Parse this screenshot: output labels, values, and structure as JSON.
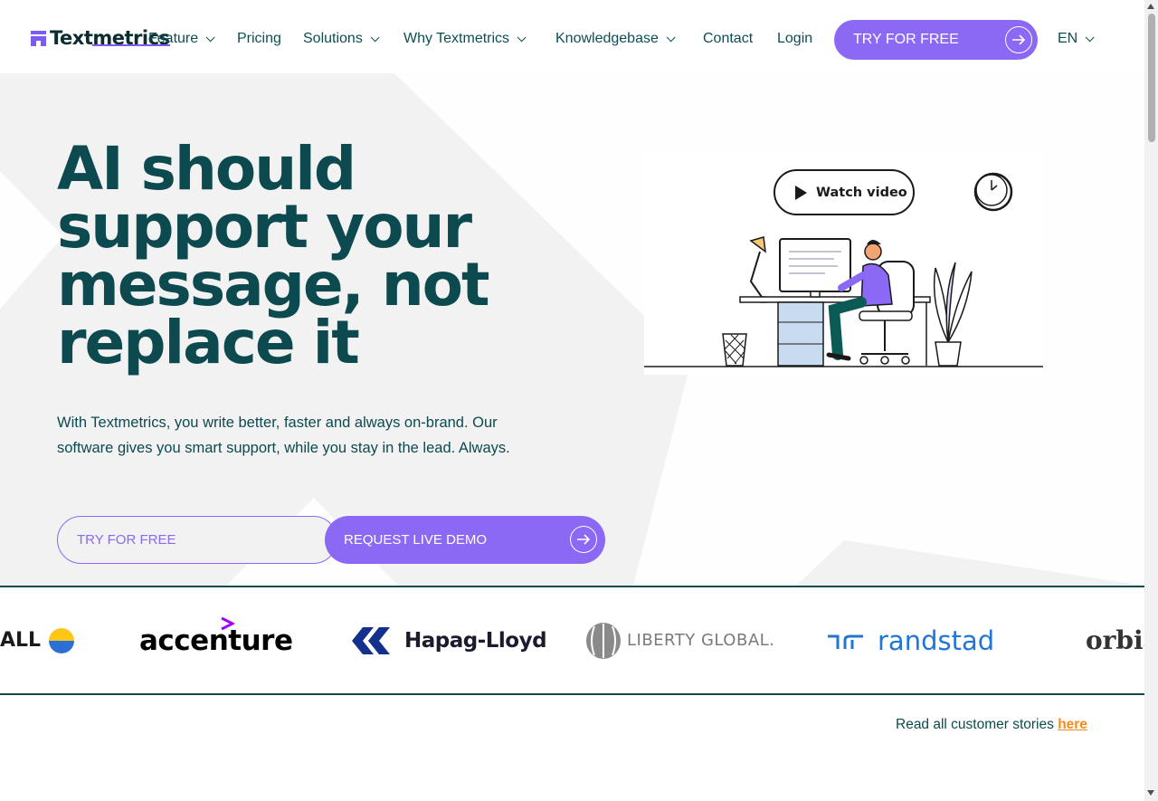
{
  "header": {
    "logo_text": "Textmetrics",
    "nav": [
      {
        "label": "Feature",
        "has_dropdown": true
      },
      {
        "label": "Pricing",
        "has_dropdown": false
      },
      {
        "label": "Solutions",
        "has_dropdown": true
      },
      {
        "label": "Why Textmetrics",
        "has_dropdown": true
      },
      {
        "label": "Knowledgebase",
        "has_dropdown": true
      },
      {
        "label": "Contact",
        "has_dropdown": false
      },
      {
        "label": "Login",
        "has_dropdown": false
      }
    ],
    "cta_label": "TRY FOR FREE",
    "language": "EN"
  },
  "hero": {
    "headline_lines": [
      "AI should",
      "support your",
      "message, not",
      "replace it"
    ],
    "subtext": "With Textmetrics, you write better, faster and always on-brand. Our software gives you smart support, while you stay in the lead. Always.",
    "primary_button": "TRY FOR FREE",
    "secondary_button": "REQUEST LIVE DEMO",
    "video_button": "Watch video"
  },
  "customer_logos": [
    "ALL",
    "accenture",
    "Hapag-Lloyd",
    "LIBERTY GLOBAL.",
    "randstad",
    "orbia"
  ],
  "stories": {
    "text": "Read all customer stories ",
    "link": "here"
  },
  "colors": {
    "brand_purple": "#8b69f5",
    "dark_teal": "#0c4a4f",
    "link_orange": "#f48a1c",
    "hero_bg": "#f2f2f2"
  }
}
